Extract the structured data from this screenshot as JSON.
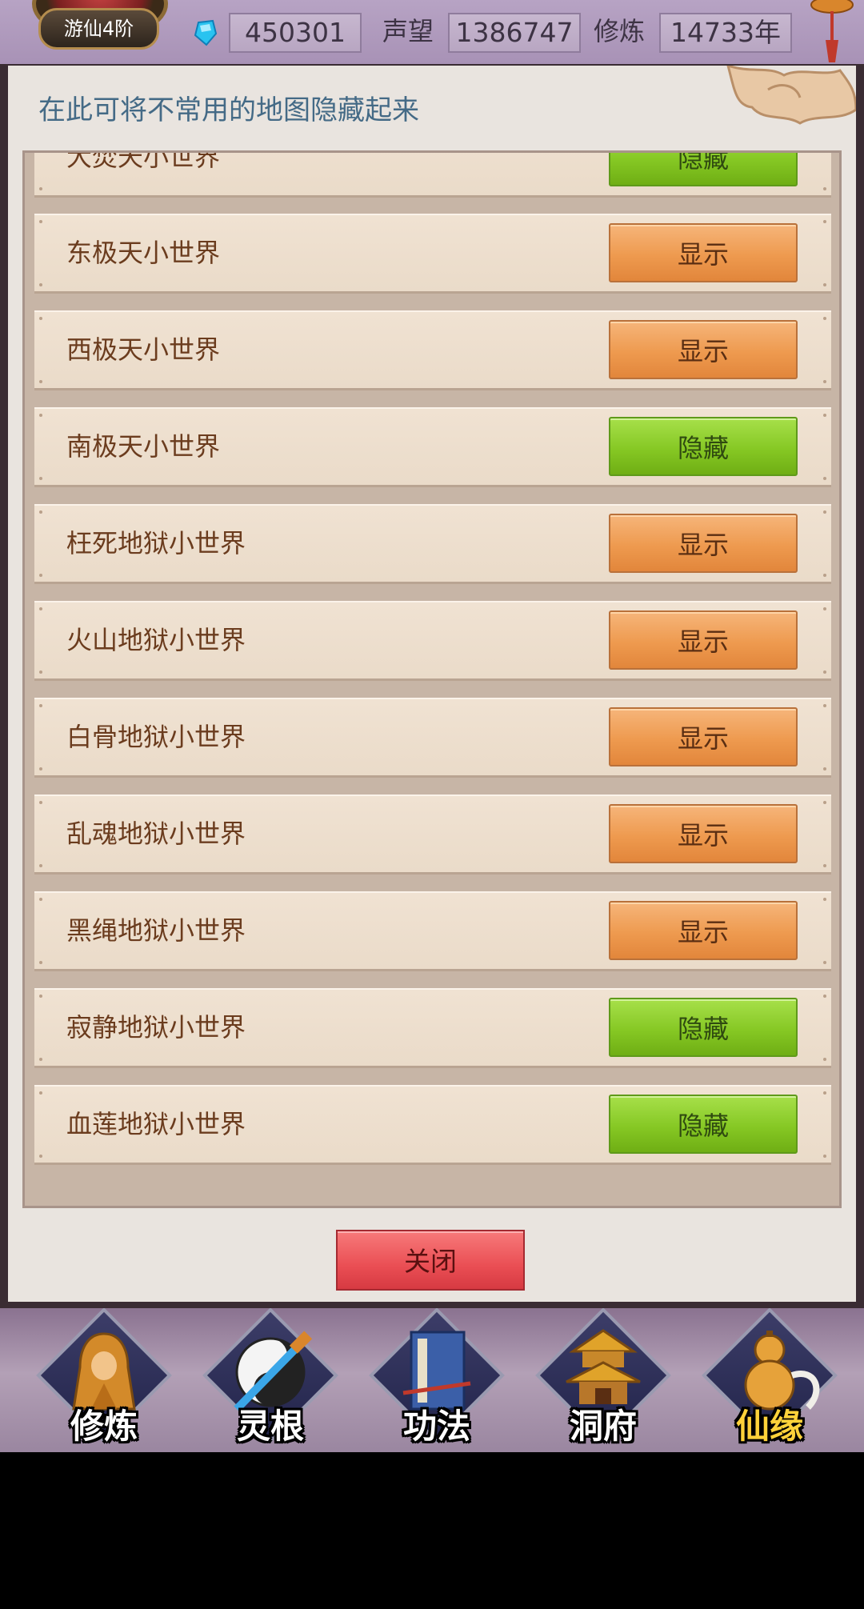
{
  "header": {
    "rank_badge": "游仙4阶",
    "gem_icon": "blue-gem-icon",
    "gem_value": "450301",
    "reputation_label": "声望",
    "reputation_value": "1386747",
    "cultivation_label": "修炼",
    "cultivation_value": "14733年"
  },
  "dialog": {
    "hint": "在此可将不常用的地图隐藏起来",
    "close_label": "关闭",
    "rows": [
      {
        "name": "大焚天小世界",
        "button": "隐藏",
        "state": "hide"
      },
      {
        "name": "东极天小世界",
        "button": "显示",
        "state": "show"
      },
      {
        "name": "西极天小世界",
        "button": "显示",
        "state": "show"
      },
      {
        "name": "南极天小世界",
        "button": "隐藏",
        "state": "hide"
      },
      {
        "name": "枉死地狱小世界",
        "button": "显示",
        "state": "show"
      },
      {
        "name": "火山地狱小世界",
        "button": "显示",
        "state": "show"
      },
      {
        "name": "白骨地狱小世界",
        "button": "显示",
        "state": "show"
      },
      {
        "name": "乱魂地狱小世界",
        "button": "显示",
        "state": "show"
      },
      {
        "name": "黑绳地狱小世界",
        "button": "显示",
        "state": "show"
      },
      {
        "name": "寂静地狱小世界",
        "button": "隐藏",
        "state": "hide"
      },
      {
        "name": "血莲地狱小世界",
        "button": "隐藏",
        "state": "hide"
      }
    ]
  },
  "bottom_nav": [
    {
      "label": "修炼",
      "icon": "hooded-monk-icon"
    },
    {
      "label": "灵根",
      "icon": "yin-yang-sword-icon"
    },
    {
      "label": "功法",
      "icon": "scripture-book-icon"
    },
    {
      "label": "洞府",
      "icon": "pagoda-icon"
    },
    {
      "label": "仙缘",
      "icon": "gourd-icon"
    }
  ],
  "colors": {
    "show_button": "#ee9a4f",
    "hide_button": "#86c824",
    "close_button": "#ea4e54",
    "hint_text": "#446a86",
    "row_text": "#6b3c1e"
  }
}
